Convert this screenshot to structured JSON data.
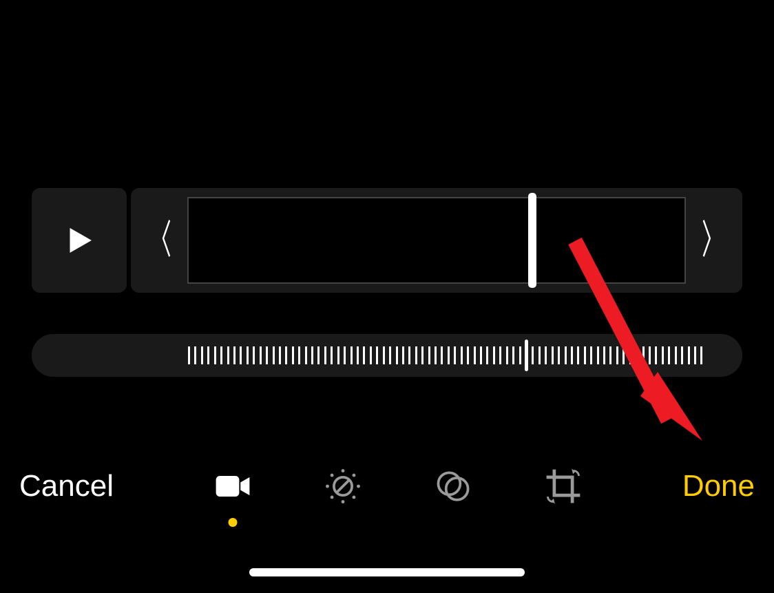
{
  "toolbar": {
    "cancel_label": "Cancel",
    "done_label": "Done"
  },
  "modes": {
    "video": "video",
    "adjust": "adjust",
    "filters": "filters",
    "crop": "crop",
    "active": "video"
  },
  "timeline": {
    "playhead_percent": 68.5
  },
  "scrubber": {
    "playhead_percent": 69.4,
    "tick_count": 80
  },
  "colors": {
    "accent": "#ffcc00",
    "annotation": "#ed1c24"
  },
  "annotation": {
    "type": "arrow",
    "points_to": "done-button"
  }
}
